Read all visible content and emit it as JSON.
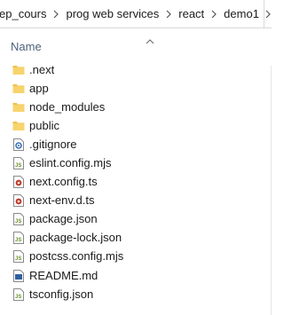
{
  "breadcrumb": [
    "ep_cours",
    "prog web services",
    "react",
    "demo1"
  ],
  "column_header": {
    "name_label": "Name"
  },
  "files": [
    {
      "name": ".next",
      "icon": "folder-icon"
    },
    {
      "name": "app",
      "icon": "folder-icon"
    },
    {
      "name": "node_modules",
      "icon": "folder-icon"
    },
    {
      "name": "public",
      "icon": "folder-icon"
    },
    {
      "name": ".gitignore",
      "icon": "gear-file-icon"
    },
    {
      "name": "eslint.config.mjs",
      "icon": "js-file-icon"
    },
    {
      "name": "next.config.ts",
      "icon": "ts-file-icon"
    },
    {
      "name": "next-env.d.ts",
      "icon": "ts-file-icon"
    },
    {
      "name": "package.json",
      "icon": "json-file-icon"
    },
    {
      "name": "package-lock.json",
      "icon": "json-file-icon"
    },
    {
      "name": "postcss.config.mjs",
      "icon": "js-file-icon"
    },
    {
      "name": "README.md",
      "icon": "markdown-file-icon"
    },
    {
      "name": "tsconfig.json",
      "icon": "json-file-icon"
    }
  ],
  "colors": {
    "folder": "#f0c24b",
    "header_text": "#4c607a"
  }
}
